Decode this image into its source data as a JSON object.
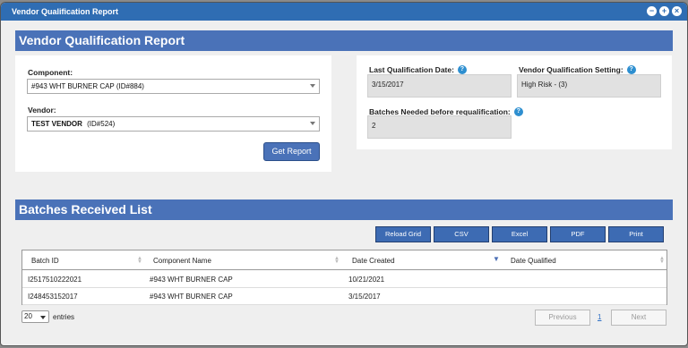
{
  "window": {
    "title": "Vendor Qualification Report",
    "controls": [
      "minimize-icon",
      "maximize-icon",
      "close-icon"
    ]
  },
  "report": {
    "header": "Vendor Qualification Report",
    "component_label": "Component:",
    "component_value": "#943 WHT BURNER CAP  (ID#884)",
    "vendor_label": "Vendor:",
    "vendor_value_name": "TEST VENDOR",
    "vendor_value_id": "(ID#524)",
    "get_report_label": "Get Report",
    "last_qual_label": "Last Qualification Date:",
    "last_qual_value": "3/15/2017",
    "setting_label": "Vendor Qualification Setting:",
    "setting_value": "High Risk - (3)",
    "batches_needed_label": "Batches Needed before requalification:",
    "batches_needed_value": "2"
  },
  "batches": {
    "header": "Batches Received List",
    "toolbar": [
      "Reload Grid",
      "CSV",
      "Excel",
      "PDF",
      "Print"
    ],
    "columns": [
      "Batch ID",
      "Component Name",
      "Date Created",
      "Date Qualified"
    ],
    "rows": [
      [
        "I2517510222021",
        "#943 WHT BURNER CAP",
        "10/21/2021",
        ""
      ],
      [
        "I248453152017",
        "#943 WHT BURNER CAP",
        "3/15/2017",
        ""
      ]
    ],
    "page_length": "20",
    "entries_label": "entries",
    "previous_label": "Previous",
    "current_page": "1",
    "next_label": "Next"
  },
  "colors": {
    "titlebar": "#2f6db3",
    "section_header": "#4a72b8",
    "button": "#3d6bb3"
  }
}
